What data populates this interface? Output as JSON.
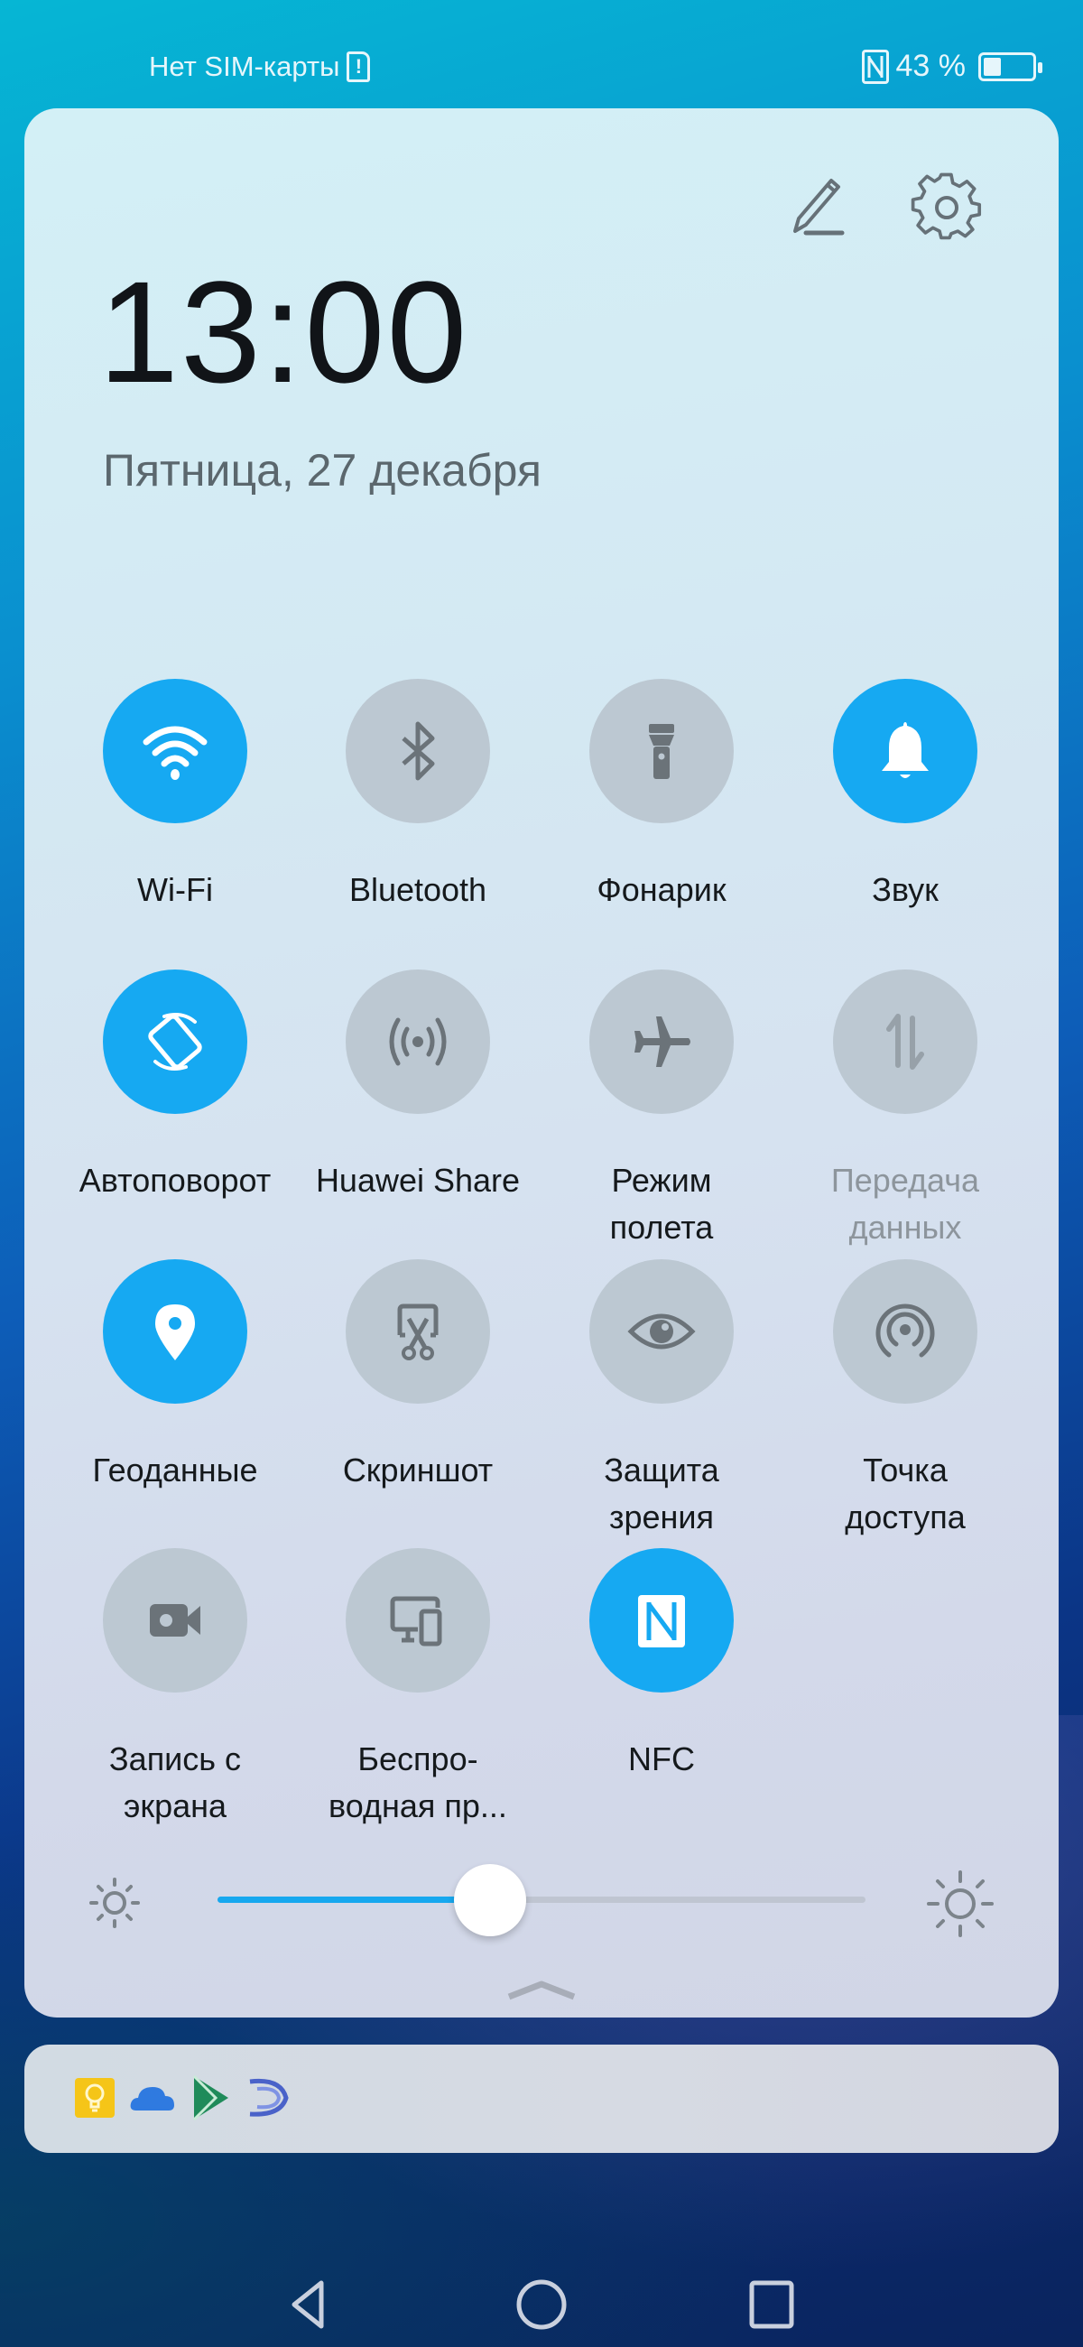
{
  "status_bar": {
    "carrier_text": "Нет SIM-карты",
    "sim_alert_glyph": "!",
    "icons": [
      "sim-alert-icon",
      "nfc-icon",
      "battery-icon"
    ],
    "battery_percent_text": "43 %",
    "battery_level": 0.43
  },
  "header": {
    "time": "13:00",
    "date": "Пятница, 27 декабря",
    "edit_icon": "pencil-icon",
    "settings_icon": "gear-icon"
  },
  "toggles": [
    {
      "label": "Wi-Fi",
      "icon": "wifi-icon",
      "state": "on"
    },
    {
      "label": "Bluetooth",
      "icon": "bluetooth-icon",
      "state": "off"
    },
    {
      "label": "Фонарик",
      "icon": "flashlight-icon",
      "state": "off"
    },
    {
      "label": "Звук",
      "icon": "bell-icon",
      "state": "on"
    },
    {
      "label": "Автоповорот",
      "icon": "auto-rotate-icon",
      "state": "on"
    },
    {
      "label": "Huawei Share",
      "icon": "huawei-share-icon",
      "state": "off"
    },
    {
      "label": "Режим\nполета",
      "icon": "airplane-icon",
      "state": "off"
    },
    {
      "label": "Передача\nданных",
      "icon": "mobile-data-icon",
      "state": "disabled"
    },
    {
      "label": "Геоданные",
      "icon": "location-icon",
      "state": "on"
    },
    {
      "label": "Скриншот",
      "icon": "screenshot-icon",
      "state": "off"
    },
    {
      "label": "Защита\nзрения",
      "icon": "eye-comfort-icon",
      "state": "off"
    },
    {
      "label": "Точка\nдоступа",
      "icon": "hotspot-icon",
      "state": "off"
    },
    {
      "label": "Запись с\nэкрана",
      "icon": "screen-record-icon",
      "state": "off"
    },
    {
      "label": "Беспро-\nводная пр...",
      "icon": "wireless-projection-icon",
      "state": "off"
    },
    {
      "label": "NFC",
      "icon": "nfc-icon",
      "state": "on"
    }
  ],
  "brightness": {
    "level": 0.42,
    "min_icon": "brightness-low-icon",
    "max_icon": "brightness-high-icon"
  },
  "expand_handle_icon": "chevron-up-icon",
  "notifications": {
    "app_icons": [
      "google-keep-icon",
      "onedrive-cloud-icon",
      "play-store-icon",
      "swiftkey-icon"
    ]
  },
  "navigation": {
    "buttons": [
      "back-icon",
      "home-icon",
      "recents-icon"
    ]
  },
  "colors": {
    "accent": "#16a9f2",
    "toggle_off": "#bcc8d2",
    "icon_gray": "#6b7379"
  }
}
